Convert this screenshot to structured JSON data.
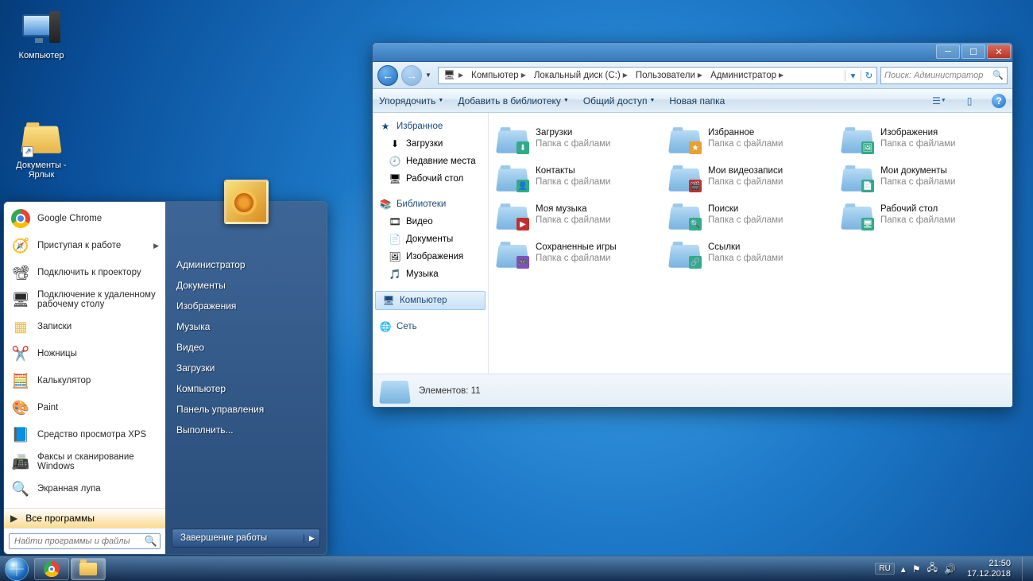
{
  "desktop_icons": [
    {
      "label": "Компьютер"
    },
    {
      "label": "Документы - Ярлык"
    }
  ],
  "start_menu": {
    "programs": [
      {
        "label": "Google Chrome",
        "icon": "chrome"
      },
      {
        "label": "Приступая к работе",
        "icon": "getting-started",
        "submenu": true
      },
      {
        "label": "Подключить к проектору",
        "icon": "projector"
      },
      {
        "label": "Подключение к удаленному рабочему столу",
        "icon": "rdp"
      },
      {
        "label": "Записки",
        "icon": "sticky"
      },
      {
        "label": "Ножницы",
        "icon": "snip"
      },
      {
        "label": "Калькулятор",
        "icon": "calc"
      },
      {
        "label": "Paint",
        "icon": "paint"
      },
      {
        "label": "Средство просмотра XPS",
        "icon": "xps"
      },
      {
        "label": "Факсы и сканирование Windows",
        "icon": "fax"
      },
      {
        "label": "Экранная лупа",
        "icon": "magnifier"
      }
    ],
    "all_programs": "Все программы",
    "search_placeholder": "Найти программы и файлы",
    "right": [
      "Администратор",
      "Документы",
      "Изображения",
      "Музыка",
      "Видео",
      "Загрузки",
      "Компьютер",
      "Панель управления",
      "Выполнить..."
    ],
    "shutdown": "Завершение работы"
  },
  "explorer": {
    "breadcrumb": [
      "Компьютер",
      "Локальный диск (C:)",
      "Пользователи",
      "Администратор"
    ],
    "search_placeholder": "Поиск: Администратор",
    "toolbar": {
      "organize": "Упорядочить",
      "library": "Добавить в библиотеку",
      "share": "Общий доступ",
      "newfolder": "Новая папка"
    },
    "sidebar": {
      "favorites": {
        "head": "Избранное",
        "items": [
          "Загрузки",
          "Недавние места",
          "Рабочий стол"
        ]
      },
      "libraries": {
        "head": "Библиотеки",
        "items": [
          "Видео",
          "Документы",
          "Изображения",
          "Музыка"
        ]
      },
      "computer": "Компьютер",
      "network": "Сеть"
    },
    "folders": [
      {
        "name": "Загрузки",
        "sub": "Папка с файлами"
      },
      {
        "name": "Избранное",
        "sub": "Папка с файлами"
      },
      {
        "name": "Изображения",
        "sub": "Папка с файлами"
      },
      {
        "name": "Контакты",
        "sub": "Папка с файлами"
      },
      {
        "name": "Мои видеозаписи",
        "sub": "Папка с файлами"
      },
      {
        "name": "Мои документы",
        "sub": "Папка с файлами"
      },
      {
        "name": "Моя музыка",
        "sub": "Папка с файлами"
      },
      {
        "name": "Поиски",
        "sub": "Папка с файлами"
      },
      {
        "name": "Рабочий стол",
        "sub": "Папка с файлами"
      },
      {
        "name": "Сохраненные игры",
        "sub": "Папка с файлами"
      },
      {
        "name": "Ссылки",
        "sub": "Папка с файлами"
      }
    ],
    "status": "Элементов: 11"
  },
  "taskbar": {
    "lang": "RU",
    "time": "21:50",
    "date": "17.12.2018"
  }
}
